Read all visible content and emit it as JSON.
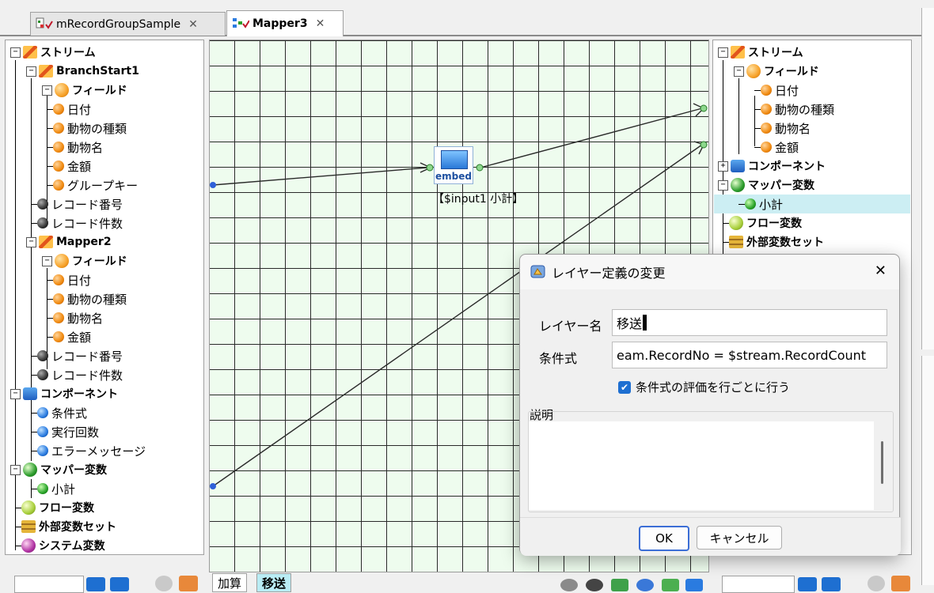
{
  "tabs": [
    {
      "label": "mRecordGroupSample",
      "active": false,
      "close": "✕"
    },
    {
      "label": "Mapper3",
      "active": true,
      "close": "✕"
    }
  ],
  "left_tree": {
    "stream": "ストリーム",
    "branch1": {
      "name": "BranchStart1",
      "field_group": "フィールド",
      "fields": [
        "日付",
        "動物の種類",
        "動物名",
        "金額",
        "グループキー"
      ],
      "record_no": "レコード番号",
      "record_count": "レコード件数"
    },
    "branch2": {
      "name": "Mapper2",
      "field_group": "フィールド",
      "fields": [
        "日付",
        "動物の種類",
        "動物名",
        "金額"
      ],
      "record_no": "レコード番号",
      "record_count": "レコード件数"
    },
    "component": "コンポーネント",
    "component_items": [
      "条件式",
      "実行回数",
      "エラーメッセージ"
    ],
    "mapper_var": "マッパー変数",
    "mapper_var_items": [
      "小計"
    ],
    "flow_var": "フロー変数",
    "ext_var": "外部変数セット",
    "sys_var": "システム変数"
  },
  "canvas": {
    "node_icon_text": "embed",
    "node_label": "【$input1 小計】",
    "layers": [
      "加算",
      "移送"
    ],
    "active_layer": "移送"
  },
  "right_tree": {
    "stream": "ストリーム",
    "field_group": "フィールド",
    "fields": [
      "日付",
      "動物の種類",
      "動物名",
      "金額"
    ],
    "component": "コンポーネント",
    "mapper_var": "マッパー変数",
    "mapper_var_items": [
      "小計"
    ],
    "flow_var": "フロー変数",
    "ext_var": "外部変数セット"
  },
  "dialog": {
    "title": "レイヤー定義の変更",
    "close": "✕",
    "layer_name_label": "レイヤー名",
    "layer_name_value": "移送",
    "condition_label": "条件式",
    "condition_value": "eam.RecordNo = $stream.RecordCount",
    "per_row_checkbox": "条件式の評価を行ごとに行う",
    "per_row_checked": true,
    "description_label": "説明",
    "description_value": "",
    "ok": "OK",
    "cancel": "キャンセル"
  },
  "colors": {
    "canvas_bg": "#eefcee",
    "selection": "#cceef3",
    "accent": "#1e6fd1"
  }
}
